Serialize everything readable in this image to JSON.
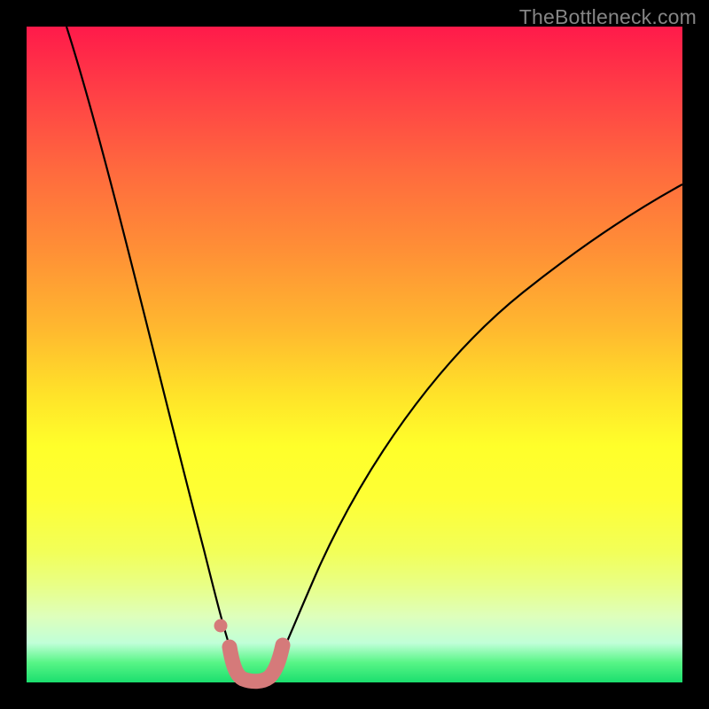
{
  "watermark": "TheBottleneck.com",
  "chart_data": {
    "type": "line",
    "title": "",
    "xlabel": "",
    "ylabel": "",
    "xlim": [
      0,
      100
    ],
    "ylim": [
      0,
      100
    ],
    "series": [
      {
        "name": "bottleneck-curve",
        "x": [
          6,
          10,
          14,
          18,
          22,
          24,
          26,
          27.5,
          29,
          30.5,
          31.5,
          32,
          33,
          34,
          35,
          36,
          37,
          38,
          40,
          44,
          50,
          56,
          62,
          70,
          80,
          90,
          100
        ],
        "values": [
          100,
          84,
          68,
          53,
          38,
          30,
          22,
          16,
          10,
          5,
          2.5,
          1.2,
          0.5,
          0.3,
          0.5,
          1.2,
          2.5,
          5,
          10,
          19,
          30,
          39,
          46,
          54,
          62,
          68,
          72
        ]
      }
    ],
    "highlight_band": {
      "name": "optimal-range",
      "x_start": 31,
      "x_end": 38,
      "color": "#d57a7a"
    },
    "highlight_dot": {
      "name": "left-shoulder-dot",
      "x": 29.2,
      "y": 9,
      "color": "#d57a7a"
    },
    "background_gradient": {
      "top": "#ff1a4a",
      "mid": "#ffff2a",
      "bottom": "#1bdf6e"
    }
  }
}
